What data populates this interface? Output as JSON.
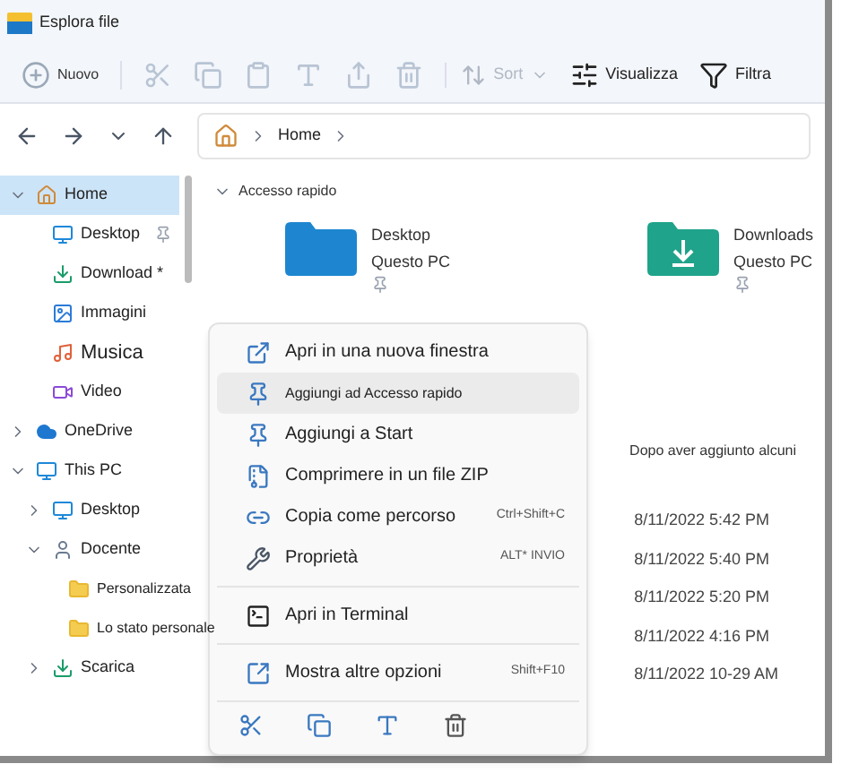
{
  "window": {
    "title": "Esplora file"
  },
  "toolbar": {
    "new_label": "Nuovo",
    "sort_label": "Sort",
    "view_label": "Visualizza",
    "filter_label": "Filtra"
  },
  "address": {
    "crumbs": [
      "Home"
    ]
  },
  "sidebar": {
    "items": [
      {
        "label": "Home",
        "kind": "home",
        "selected": true,
        "expanded": true,
        "children": [
          {
            "label": "Desktop",
            "kind": "desktop",
            "selected": false,
            "pinned": true
          },
          {
            "label": "Download *",
            "kind": "download",
            "selected": false,
            "pinned": false
          },
          {
            "label": "Immagini",
            "kind": "pictures",
            "selected": false,
            "pinned": false
          },
          {
            "label": "Musica",
            "kind": "music",
            "selected": false,
            "pinned": false
          },
          {
            "label": "Video",
            "kind": "video",
            "selected": false,
            "pinned": false
          }
        ]
      },
      {
        "label": "OneDrive",
        "kind": "cloud",
        "selected": false,
        "expanded": false
      },
      {
        "label": "This PC",
        "kind": "pc",
        "selected": false,
        "expanded": true,
        "children": [
          {
            "label": "Desktop",
            "kind": "desktop",
            "selected": false,
            "expanded": false
          },
          {
            "label": "Docente",
            "kind": "user",
            "selected": false,
            "expanded": true,
            "children": [
              {
                "label": "Personalizzata",
                "kind": "folder",
                "selected": false
              },
              {
                "label": "Lo stato personale",
                "kind": "folder",
                "selected": false
              }
            ]
          },
          {
            "label": "Scarica",
            "kind": "download",
            "selected": false,
            "expanded": false
          }
        ]
      }
    ]
  },
  "quick_access": {
    "title": "Accesso rapido",
    "expanded": true,
    "tiles": [
      {
        "name": "Desktop",
        "location": "Questo PC",
        "kind": "desktop",
        "pinned": true
      },
      {
        "name": "Downloads",
        "location": "Questo PC",
        "kind": "download",
        "pinned": true
      }
    ]
  },
  "recent": {
    "message": "Dopo aver aggiunto alcuni",
    "dates": [
      "8/11/2022 5:42 PM",
      "8/11/2022 5:40 PM",
      "8/11/2022 5:20 PM",
      "8/11/2022 4:16 PM",
      "8/11/2022 10-29 AM"
    ]
  },
  "context_menu": {
    "groups": [
      [
        {
          "label": "Apri in una nuova finestra",
          "kind": "open",
          "selected": false
        },
        {
          "label": "Aggiungi ad Accesso rapido",
          "kind": "pin",
          "selected": true
        },
        {
          "label": "Aggiungi a Start",
          "kind": "pin",
          "selected": false
        },
        {
          "label": "Comprimere in un file ZIP",
          "kind": "zip",
          "selected": false
        },
        {
          "label": "Copia come percorso",
          "kind": "path",
          "selected": false,
          "shortcut": "Ctrl+Shift+C"
        },
        {
          "label": "Proprietà",
          "kind": "properties",
          "selected": false,
          "shortcut": "ALT* INVIO"
        }
      ],
      [
        {
          "label": "Apri in Terminal",
          "kind": "terminal",
          "selected": false
        }
      ],
      [
        {
          "label": "Mostra altre opzioni",
          "kind": "more",
          "selected": false,
          "shortcut": "Shift+F10"
        }
      ]
    ]
  }
}
